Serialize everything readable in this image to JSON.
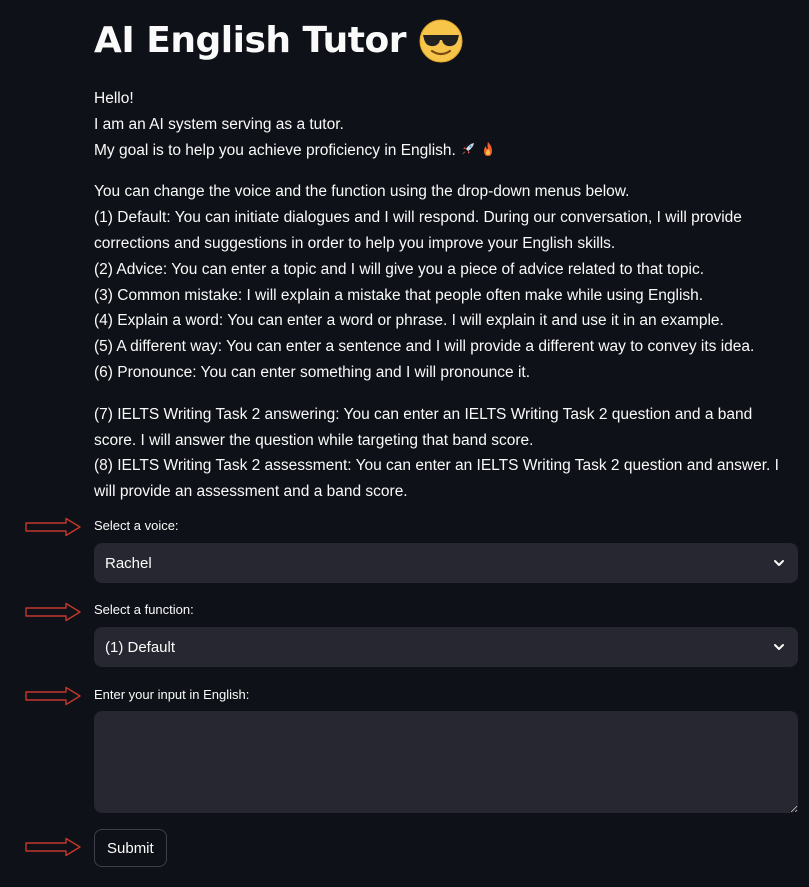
{
  "title": "AI English Tutor",
  "title_emoji": "smiling-face-with-sunglasses-icon",
  "intro": {
    "line1": "Hello!",
    "line2": "I am an AI system serving as a tutor.",
    "line3": "My goal is to help you achieve proficiency in English.",
    "line3_icons": [
      "rocket-icon",
      "fire-icon"
    ]
  },
  "functions_intro": "You can change the voice and the function using the drop-down menus below.",
  "functions": [
    "(1) Default: You can initiate dialogues and I will respond. During our conversation, I will provide corrections and suggestions in order to help you improve your English skills.",
    "(2) Advice: You can enter a topic and I will give you a piece of advice related to that topic.",
    "(3) Common mistake: I will explain a mistake that people often make while using English.",
    "(4) Explain a word: You can enter a word or phrase. I will explain it and use it in an example.",
    "(5) A different way: You can enter a sentence and I will provide a different way to convey its idea.",
    "(6) Pronounce: You can enter something and I will pronounce it."
  ],
  "ielts": [
    "(7) IELTS Writing Task 2 answering: You can enter an IELTS Writing Task 2 question and a band score. I will answer the question while targeting that band score.",
    "(8) IELTS Writing Task 2 assessment: You can enter an IELTS Writing Task 2 question and answer. I will provide an assessment and a band score."
  ],
  "voice": {
    "label": "Select a voice:",
    "value": "Rachel"
  },
  "function_select": {
    "label": "Select a function:",
    "value": "(1) Default"
  },
  "input": {
    "label": "Enter your input in English:",
    "value": ""
  },
  "submit_label": "Submit",
  "colors": {
    "background": "#0e1117",
    "widget": "#262730",
    "text": "#fafafa",
    "arrow": "#c0392b"
  }
}
